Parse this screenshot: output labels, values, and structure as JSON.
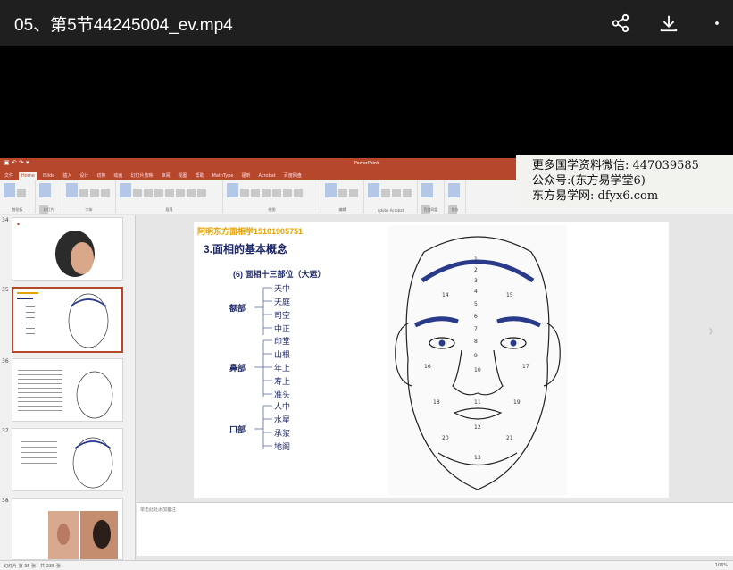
{
  "video": {
    "title": "05、第5节44245004_ev.mp4",
    "icons": [
      "share-icon",
      "download-icon",
      "more-icon"
    ]
  },
  "ppt": {
    "window_title": "PowerPoint",
    "tabs": [
      "文件",
      "Home",
      "iSlide",
      "插入",
      "设计",
      "切换",
      "动画",
      "幻灯片放映",
      "审阅",
      "视图",
      "帮助",
      "MathType",
      "福昕",
      "Acrobat",
      "百度网盘"
    ],
    "active_tab": "Home",
    "ribbon_groups": [
      "剪贴板",
      "幻灯片",
      "字体",
      "段落",
      "绘图",
      "编辑",
      "Adobe Acrobat",
      "百度网盘",
      "保存"
    ],
    "slide_numbers": [
      "34",
      "35",
      "36",
      "37",
      "38"
    ],
    "selected_slide": "35",
    "notes_placeholder": "单击此处添加备注",
    "status_left": "幻灯片 第 35 张，共 235 张",
    "status_right": "106%"
  },
  "watermark": {
    "line1": "更多国学资料微信: 447039585",
    "line2": "公众号:(东方易学堂6)",
    "line3": "东方易学网: dfyx6.com"
  },
  "slide": {
    "contact": "阿明东方面相学15101905751",
    "title": "3.面相的基本概念",
    "subtitle": "(6)  面相十三部位（大运）",
    "groups": [
      {
        "label": "额部",
        "items": [
          "天中",
          "天庭",
          "司空",
          "中正"
        ]
      },
      {
        "label": "鼻部",
        "items": [
          "印堂",
          "山根",
          "年上",
          "寿上",
          "准头"
        ]
      },
      {
        "label": "口部",
        "items": [
          "人中",
          "水星",
          "承浆",
          "地阁"
        ]
      }
    ]
  }
}
